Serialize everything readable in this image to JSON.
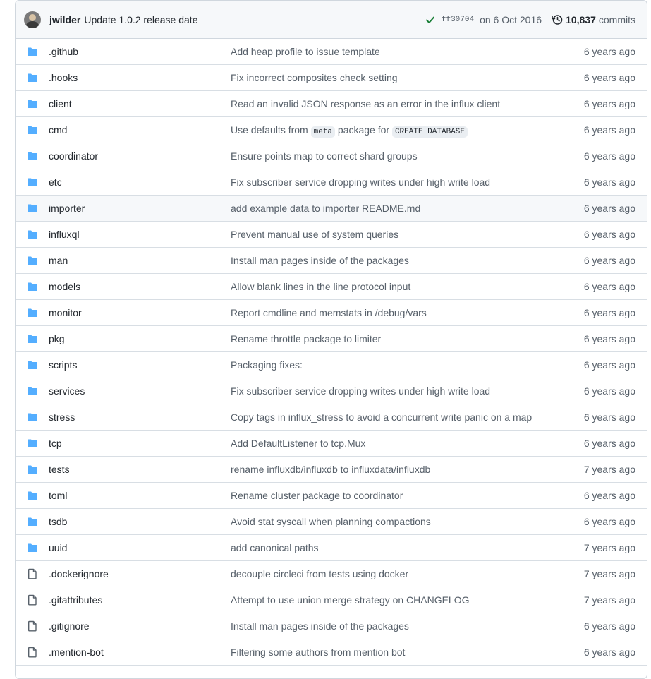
{
  "latest_commit": {
    "author": "jwilder",
    "message": "Update 1.0.2 release date",
    "sha": "ff30704",
    "date": "on 6 Oct 2016",
    "commit_count": "10,837",
    "commits_word": "commits",
    "status_color": "#1a7f37"
  },
  "colors": {
    "folder": "#54aeff",
    "file": "#57606a"
  },
  "rows": [
    {
      "type": "folder",
      "name": ".github",
      "message": "Add heap profile to issue template",
      "age": "6 years ago"
    },
    {
      "type": "folder",
      "name": ".hooks",
      "message": "Fix incorrect composites check setting",
      "age": "6 years ago"
    },
    {
      "type": "folder",
      "name": "client",
      "message": "Read an invalid JSON response as an error in the influx client",
      "age": "6 years ago"
    },
    {
      "type": "folder",
      "name": "cmd",
      "message_parts": [
        "Use defaults from ",
        "meta",
        " package for ",
        "CREATE DATABASE"
      ],
      "age": "6 years ago"
    },
    {
      "type": "folder",
      "name": "coordinator",
      "message": "Ensure points map to correct shard groups",
      "age": "6 years ago"
    },
    {
      "type": "folder",
      "name": "etc",
      "message": "Fix subscriber service dropping writes under high write load",
      "age": "6 years ago"
    },
    {
      "type": "folder",
      "name": "importer",
      "message": "add example data to importer README.md",
      "age": "6 years ago",
      "highlighted": true
    },
    {
      "type": "folder",
      "name": "influxql",
      "message": "Prevent manual use of system queries",
      "age": "6 years ago"
    },
    {
      "type": "folder",
      "name": "man",
      "message": "Install man pages inside of the packages",
      "age": "6 years ago"
    },
    {
      "type": "folder",
      "name": "models",
      "message": "Allow blank lines in the line protocol input",
      "age": "6 years ago"
    },
    {
      "type": "folder",
      "name": "monitor",
      "message": "Report cmdline and memstats in /debug/vars",
      "age": "6 years ago"
    },
    {
      "type": "folder",
      "name": "pkg",
      "message": "Rename throttle package to limiter",
      "age": "6 years ago"
    },
    {
      "type": "folder",
      "name": "scripts",
      "message": "Packaging fixes:",
      "age": "6 years ago"
    },
    {
      "type": "folder",
      "name": "services",
      "message": "Fix subscriber service dropping writes under high write load",
      "age": "6 years ago"
    },
    {
      "type": "folder",
      "name": "stress",
      "message": "Copy tags in influx_stress to avoid a concurrent write panic on a map",
      "age": "6 years ago"
    },
    {
      "type": "folder",
      "name": "tcp",
      "message": "Add DefaultListener to tcp.Mux",
      "age": "6 years ago"
    },
    {
      "type": "folder",
      "name": "tests",
      "message": "rename influxdb/influxdb to influxdata/influxdb",
      "age": "7 years ago"
    },
    {
      "type": "folder",
      "name": "toml",
      "message": "Rename cluster package to coordinator",
      "age": "6 years ago"
    },
    {
      "type": "folder",
      "name": "tsdb",
      "message": "Avoid stat syscall when planning compactions",
      "age": "6 years ago"
    },
    {
      "type": "folder",
      "name": "uuid",
      "message": "add canonical paths",
      "age": "7 years ago"
    },
    {
      "type": "file",
      "name": ".dockerignore",
      "message": "decouple circleci from tests using docker",
      "age": "7 years ago"
    },
    {
      "type": "file",
      "name": ".gitattributes",
      "message": "Attempt to use union merge strategy on CHANGELOG",
      "age": "7 years ago"
    },
    {
      "type": "file",
      "name": ".gitignore",
      "message": "Install man pages inside of the packages",
      "age": "6 years ago"
    },
    {
      "type": "file",
      "name": ".mention-bot",
      "message": "Filtering some authors from mention bot",
      "age": "6 years ago"
    }
  ]
}
